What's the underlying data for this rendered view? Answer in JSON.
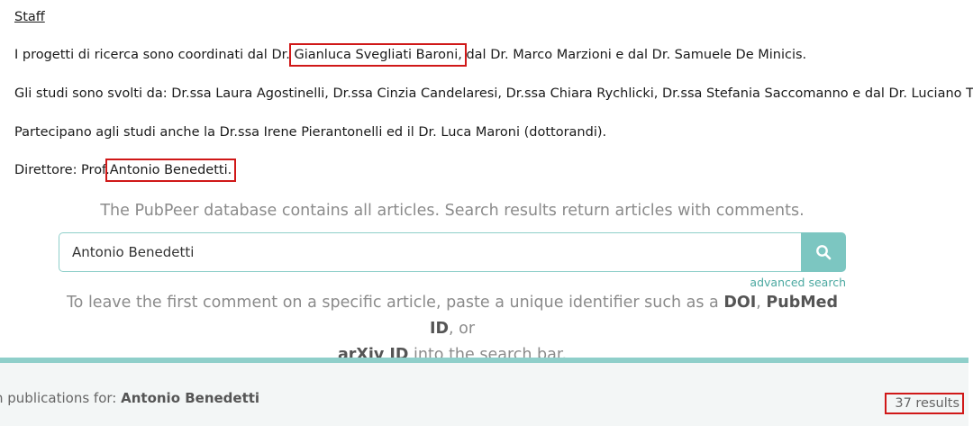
{
  "staff": {
    "title": "Staff",
    "line1_prefix": "I progetti di ricerca sono coordinati dal Dr.",
    "line1_highlight": "Gianluca Svegliati Baroni,",
    "line1_suffix": "dal Dr. Marco Marzioni e dal Dr. Samuele De Minicis.",
    "line2": "Gli studi sono svolti da: Dr.ssa Laura Agostinelli, Dr.ssa Cinzia Candelaresi, Dr.ssa Chiara Rychlicki, Dr.ssa Stefania Saccomanno e dal Dr. Luciano Trozzi.",
    "line3": "Partecipano agli studi anche la Dr.ssa Irene Pierantonelli ed il Dr. Luca Maroni (dottorandi).",
    "line4_prefix": "Direttore: Prof.",
    "line4_highlight": "Antonio Benedetti."
  },
  "pubpeer": {
    "tagline": "The PubPeer database contains all articles. Search results return articles with comments.",
    "search_value": "Antonio Benedetti",
    "advanced_search": "advanced search",
    "hint_1": "To leave the first comment on a specific article, paste a unique identifier such as a ",
    "hint_doi": "DOI",
    "hint_sep1": ", ",
    "hint_pmid": "PubMed ID",
    "hint_sep2": ", or ",
    "hint_arxiv": "arXiv ID",
    "hint_2": " into the search bar.",
    "results_prefix": "n publications for: ",
    "results_query": "Antonio Benedetti",
    "results_count": "37 results"
  },
  "colors": {
    "accent": "#7cc6c1",
    "highlight_box": "#d01818"
  },
  "icons": {
    "search": "search-icon"
  }
}
